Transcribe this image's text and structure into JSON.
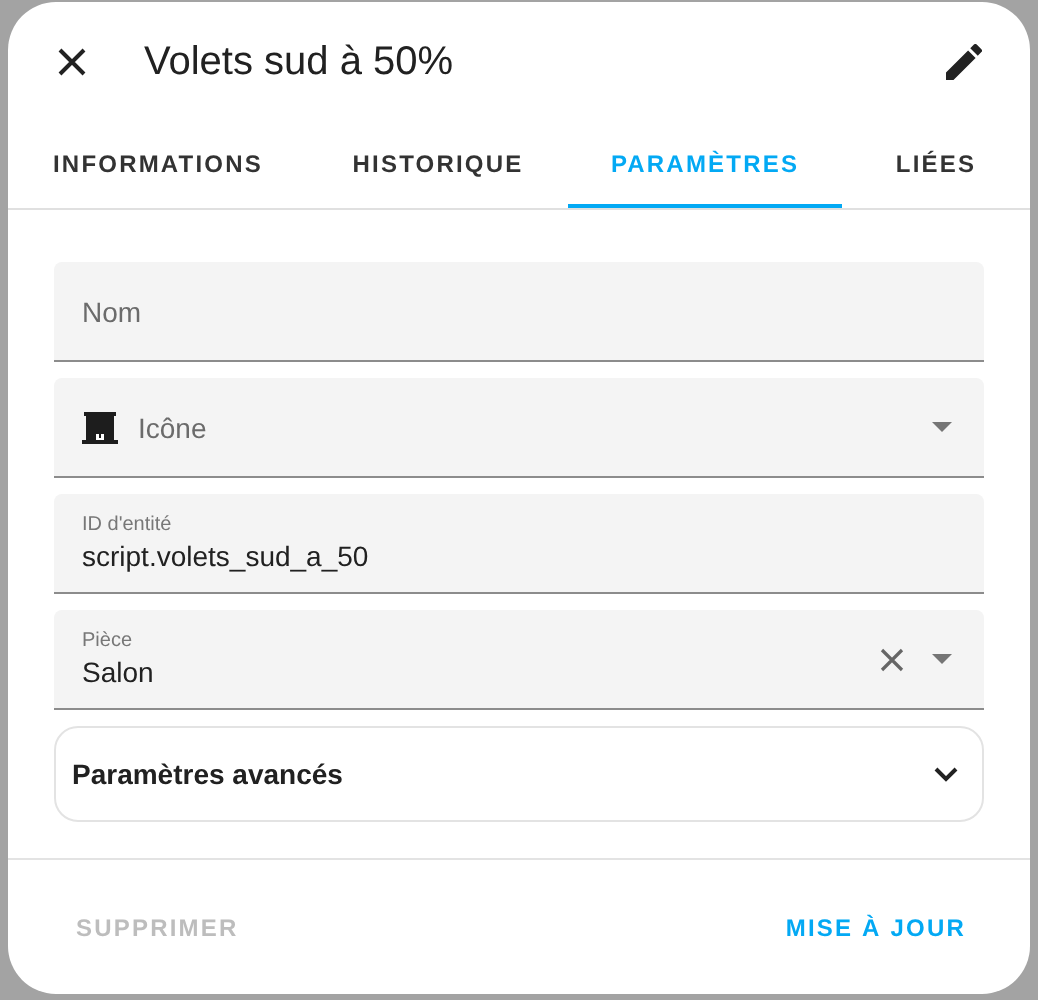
{
  "dialog": {
    "title": "Volets sud à 50%"
  },
  "tabs": [
    {
      "label": "INFORMATIONS",
      "selected": false
    },
    {
      "label": "HISTORIQUE",
      "selected": false
    },
    {
      "label": "PARAMÈTRES",
      "selected": true
    },
    {
      "label": "LIÉES",
      "selected": false
    }
  ],
  "fields": [
    {
      "kind": "text",
      "label": "Nom"
    },
    {
      "kind": "icon-select",
      "label": "Icône"
    },
    {
      "kind": "text",
      "label": "ID d'entité",
      "value": "script.volets_sud_a_50"
    },
    {
      "kind": "select",
      "label": "Pièce",
      "value": "Salon",
      "clearable": true
    }
  ],
  "advanced": {
    "label": "Paramètres avancés",
    "expanded": false
  },
  "buttons": [
    {
      "label": "SUPPRIMER",
      "disabled": true
    },
    {
      "label": "MISE À JOUR",
      "disabled": false
    }
  ]
}
